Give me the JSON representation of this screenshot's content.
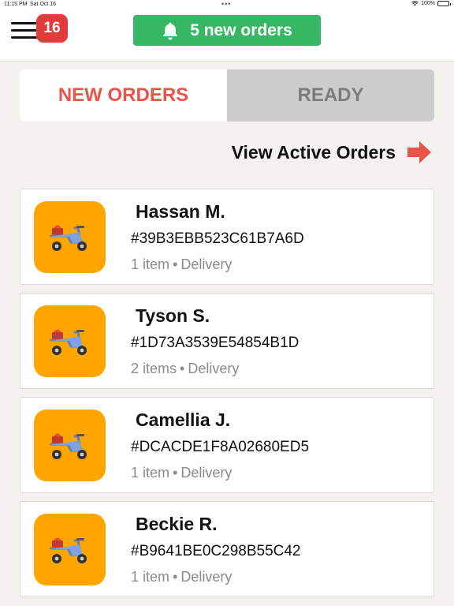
{
  "status_bar": {
    "time": "11:15 PM",
    "date": "Sat Oct 16",
    "battery": "100%"
  },
  "header": {
    "menu_badge": "16",
    "new_orders_label": "5 new orders",
    "new_orders_color": "#37b664",
    "badge_color": "#e23b3b"
  },
  "tabs": [
    {
      "label": "NEW ORDERS",
      "active": true
    },
    {
      "label": "READY",
      "active": false
    }
  ],
  "view_active_label": "View Active Orders",
  "accent_color": "#e8544a",
  "orders": [
    {
      "name": "Hassan M.",
      "id": "#39B3EBB523C61B7A6D",
      "items": "1 item",
      "type": "Delivery",
      "icon": "scooter-icon"
    },
    {
      "name": "Tyson S.",
      "id": "#1D73A3539E54854B1D",
      "items": "2 items",
      "type": "Delivery",
      "icon": "scooter-icon"
    },
    {
      "name": "Camellia J.",
      "id": "#DCACDE1F8A02680ED5",
      "items": "1 item",
      "type": "Delivery",
      "icon": "scooter-icon"
    },
    {
      "name": "Beckie R.",
      "id": "#B9641BE0C298B55C42",
      "items": "1 item",
      "type": "Delivery",
      "icon": "scooter-icon"
    }
  ]
}
